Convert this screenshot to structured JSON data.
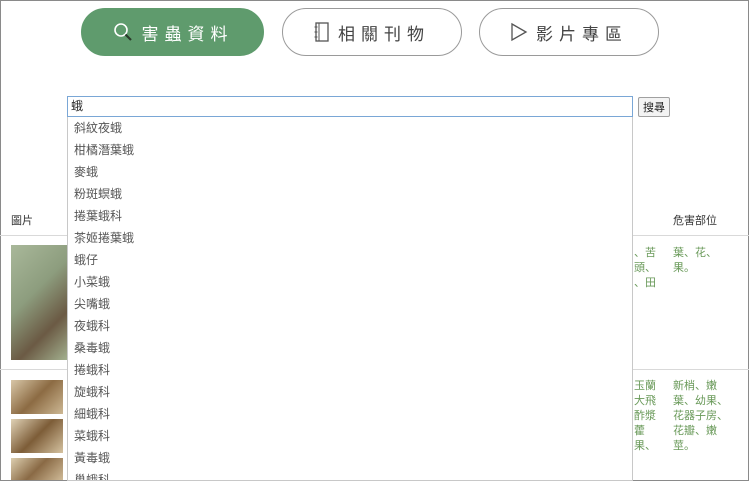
{
  "tabs": [
    {
      "label": "害蟲資料",
      "icon": "magnifier-icon"
    },
    {
      "label": "相關刊物",
      "icon": "notebook-icon"
    },
    {
      "label": "影片專區",
      "icon": "play-icon"
    }
  ],
  "search": {
    "value": "蛾",
    "button_label": "搜尋"
  },
  "suggestions": [
    "斜紋夜蛾",
    "柑橘潛葉蛾",
    "麥蛾",
    "粉斑螟蛾",
    "捲葉蛾科",
    "茶姬捲葉蛾",
    "蛾仔",
    "小菜蛾",
    "尖嘴蛾",
    "夜蛾科",
    "桑毒蛾",
    "捲蛾科",
    "旋蛾科",
    "細蛾科",
    "菜蛾科",
    "黃毒蛾",
    "巢蛾科"
  ],
  "table": {
    "col_image": "圖片",
    "col_damage_part": "危害部位",
    "rows": [
      {
        "host_partial": [
          "、苦",
          "頭、",
          "、田"
        ],
        "damage_part": [
          "葉、花、",
          "果。"
        ]
      },
      {
        "host_partial": [
          "玉蘭",
          "大飛",
          "酢漿",
          "藿",
          "果、"
        ],
        "damage_part": [
          "新梢、嫩",
          "葉、幼果、",
          "花器子房、",
          "花瓣、嫩",
          "莖。"
        ]
      }
    ]
  },
  "colors": {
    "accent": "#5f9b6d",
    "link_green": "#6a9a5a"
  }
}
